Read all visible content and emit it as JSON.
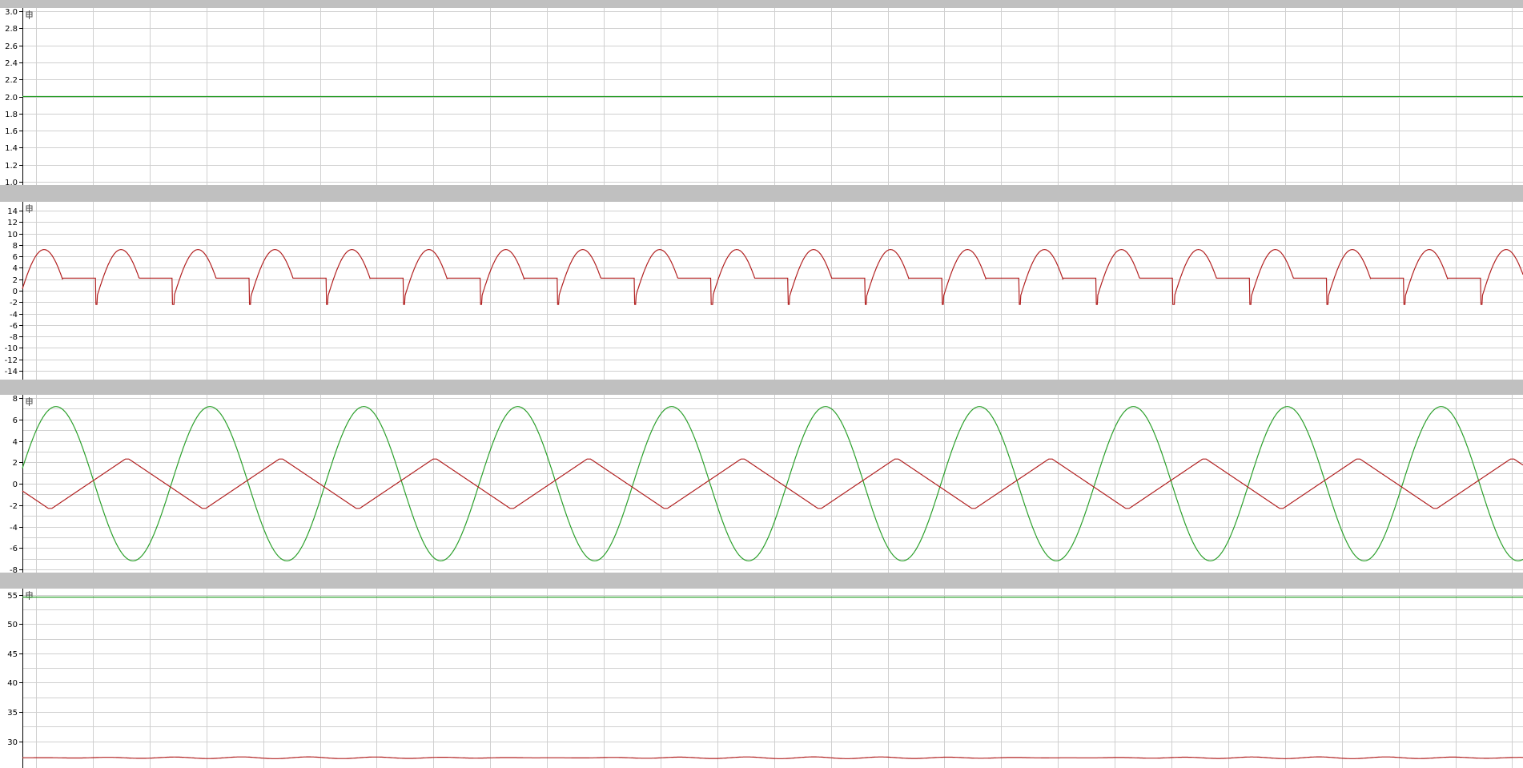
{
  "colors": {
    "separator": "#c0c0c0",
    "plot_background": "#ffffff",
    "grid": "#d0d0d0",
    "green": "#2ca02c",
    "red": "#b22222"
  },
  "icons": {
    "panel_icon": "scope-cursor-icon"
  },
  "chart_data": [
    {
      "type": "line",
      "panel": 1,
      "ylim": [
        1.0,
        3.0
      ],
      "yticks": [
        "1.0",
        "1.2",
        "1.4",
        "1.6",
        "1.8",
        "2.0",
        "2.2",
        "2.4",
        "2.6",
        "2.8",
        "3.0"
      ],
      "grid": true,
      "series": [
        {
          "color": "green",
          "kind": "constant",
          "value": 2.0
        }
      ]
    },
    {
      "type": "line",
      "panel": 2,
      "ylim": [
        -15,
        15
      ],
      "yticks": [
        "-14",
        "-12",
        "-10",
        "-8",
        "-6",
        "-4",
        "-2",
        "0",
        "2",
        "4",
        "6",
        "8",
        "10",
        "12",
        "14"
      ],
      "grid": true,
      "series": [
        {
          "color": "red",
          "kind": "rectified_sine",
          "peak": 7.2,
          "plateau": 2.2,
          "drop": -2.4,
          "cycles": 19.5
        }
      ]
    },
    {
      "type": "line",
      "panel": 3,
      "ylim": [
        -8,
        8
      ],
      "yticks": [
        "-8",
        "-6",
        "-4",
        "-2",
        "0",
        "2",
        "4",
        "6",
        "8"
      ],
      "grid": true,
      "series": [
        {
          "color": "green",
          "kind": "clipped_sine",
          "peak": 7.2,
          "cycles": 9.75
        },
        {
          "color": "red",
          "kind": "triangle",
          "amplitude": 2.3,
          "cycles": 9.75
        }
      ]
    },
    {
      "type": "line",
      "panel": 4,
      "ylim": [
        26,
        55.5
      ],
      "yticks": [
        "30",
        "35",
        "40",
        "45",
        "50",
        "55"
      ],
      "grid": true,
      "series": [
        {
          "color": "green",
          "kind": "constant",
          "value": 54.6
        },
        {
          "color": "red",
          "kind": "constant_noise",
          "value": 27.2
        }
      ]
    }
  ]
}
